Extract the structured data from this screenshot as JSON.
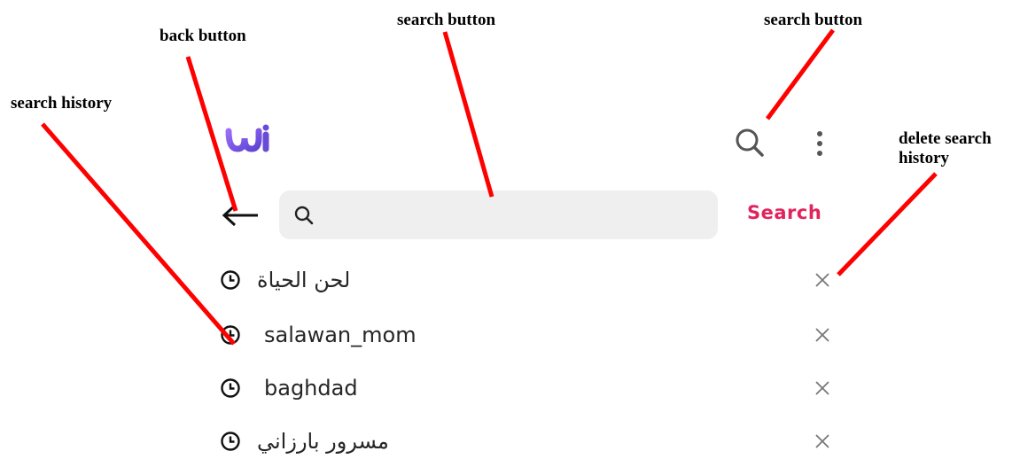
{
  "annotations": {
    "back_button": "back button",
    "search_button_center": "search button",
    "search_button_right": "search button",
    "search_history": "search history",
    "delete_search_history": "delete search\nhistory"
  },
  "header": {
    "logo_icon": "app-logo",
    "search_icon": "search-icon",
    "more_icon": "more-vertical-icon"
  },
  "search": {
    "back_icon": "arrow-left-icon",
    "placeholder": "",
    "value": "",
    "button_label": "Search",
    "accent_color": "#e0245e"
  },
  "history": [
    {
      "text": "لحن الحياة",
      "direction": "rtl"
    },
    {
      "text": "salawan_mom",
      "direction": "ltr"
    },
    {
      "text": "baghdad",
      "direction": "ltr"
    },
    {
      "text": "مسرور بارزاني",
      "direction": "rtl"
    }
  ],
  "colors": {
    "annotation_line": "#ff0000",
    "logo_gradient_start": "#8a5cf6",
    "logo_gradient_end": "#6a4bd8"
  }
}
